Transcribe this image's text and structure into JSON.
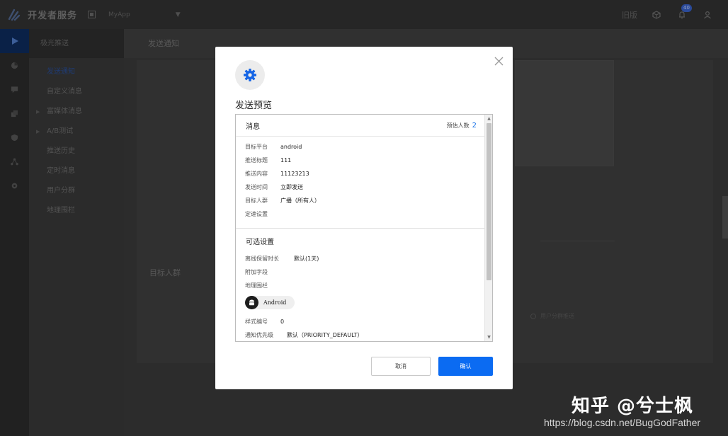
{
  "topbar": {
    "brand": "开发者服务",
    "app_name": "MyApp",
    "old_version": "旧版",
    "notification_count": "40",
    "icons": [
      "logo-icon",
      "app-switch-icon",
      "chevron-down-icon",
      "cube-icon",
      "bell-icon",
      "user-icon"
    ]
  },
  "rail": {
    "icons": [
      "play-icon",
      "pie-chart-icon",
      "chat-icon",
      "puzzle-icon",
      "shield-icon",
      "network-icon",
      "gear-icon"
    ]
  },
  "subnav": {
    "title": "极光推送",
    "items": [
      {
        "label": "发送通知",
        "active": true,
        "expandable": false
      },
      {
        "label": "自定义消息",
        "active": false,
        "expandable": false
      },
      {
        "label": "富媒体消息",
        "active": false,
        "expandable": true
      },
      {
        "label": "A/B测试",
        "active": false,
        "expandable": true
      },
      {
        "label": "推送历史",
        "active": false,
        "expandable": false
      },
      {
        "label": "定时消息",
        "active": false,
        "expandable": false
      },
      {
        "label": "用户分群",
        "active": false,
        "expandable": false
      },
      {
        "label": "地理围栏",
        "active": false,
        "expandable": false
      }
    ]
  },
  "main": {
    "header": "发送通知",
    "target_section_title": "目标人群",
    "segment_option": "用户分群推送"
  },
  "modal": {
    "title": "发送预览",
    "message_section": {
      "title": "消息",
      "estimate_label": "预估人数",
      "estimate_value": "2",
      "rows": [
        {
          "key": "目标平台",
          "value": "android"
        },
        {
          "key": "推送标题",
          "value": "111"
        },
        {
          "key": "推送内容",
          "value": "11123213"
        },
        {
          "key": "发送时间",
          "value": "立即发送"
        },
        {
          "key": "目标人群",
          "value": "广播（所有人）"
        },
        {
          "key": "定速设置",
          "value": ""
        }
      ]
    },
    "optional_section": {
      "title": "可选设置",
      "offline_key": "离线保留时长",
      "offline_value": "默认(1天)",
      "extra_fields_key": "附加字段",
      "geofence_key": "地理围栏",
      "platform_chip": "Android",
      "style_key": "样式编号",
      "style_value": "0",
      "priority_key": "通知优先级",
      "priority_value": "默认（PRIORITY_DEFAULT）"
    },
    "cancel_label": "取消",
    "confirm_label": "确认"
  },
  "watermark": {
    "main": "知乎 @兮士枫",
    "url": "https://blog.csdn.net/BugGodFather"
  },
  "colors": {
    "primary": "#0b6bf2",
    "estimate": "#1a73e8",
    "overlay": "#1c1c1c"
  }
}
